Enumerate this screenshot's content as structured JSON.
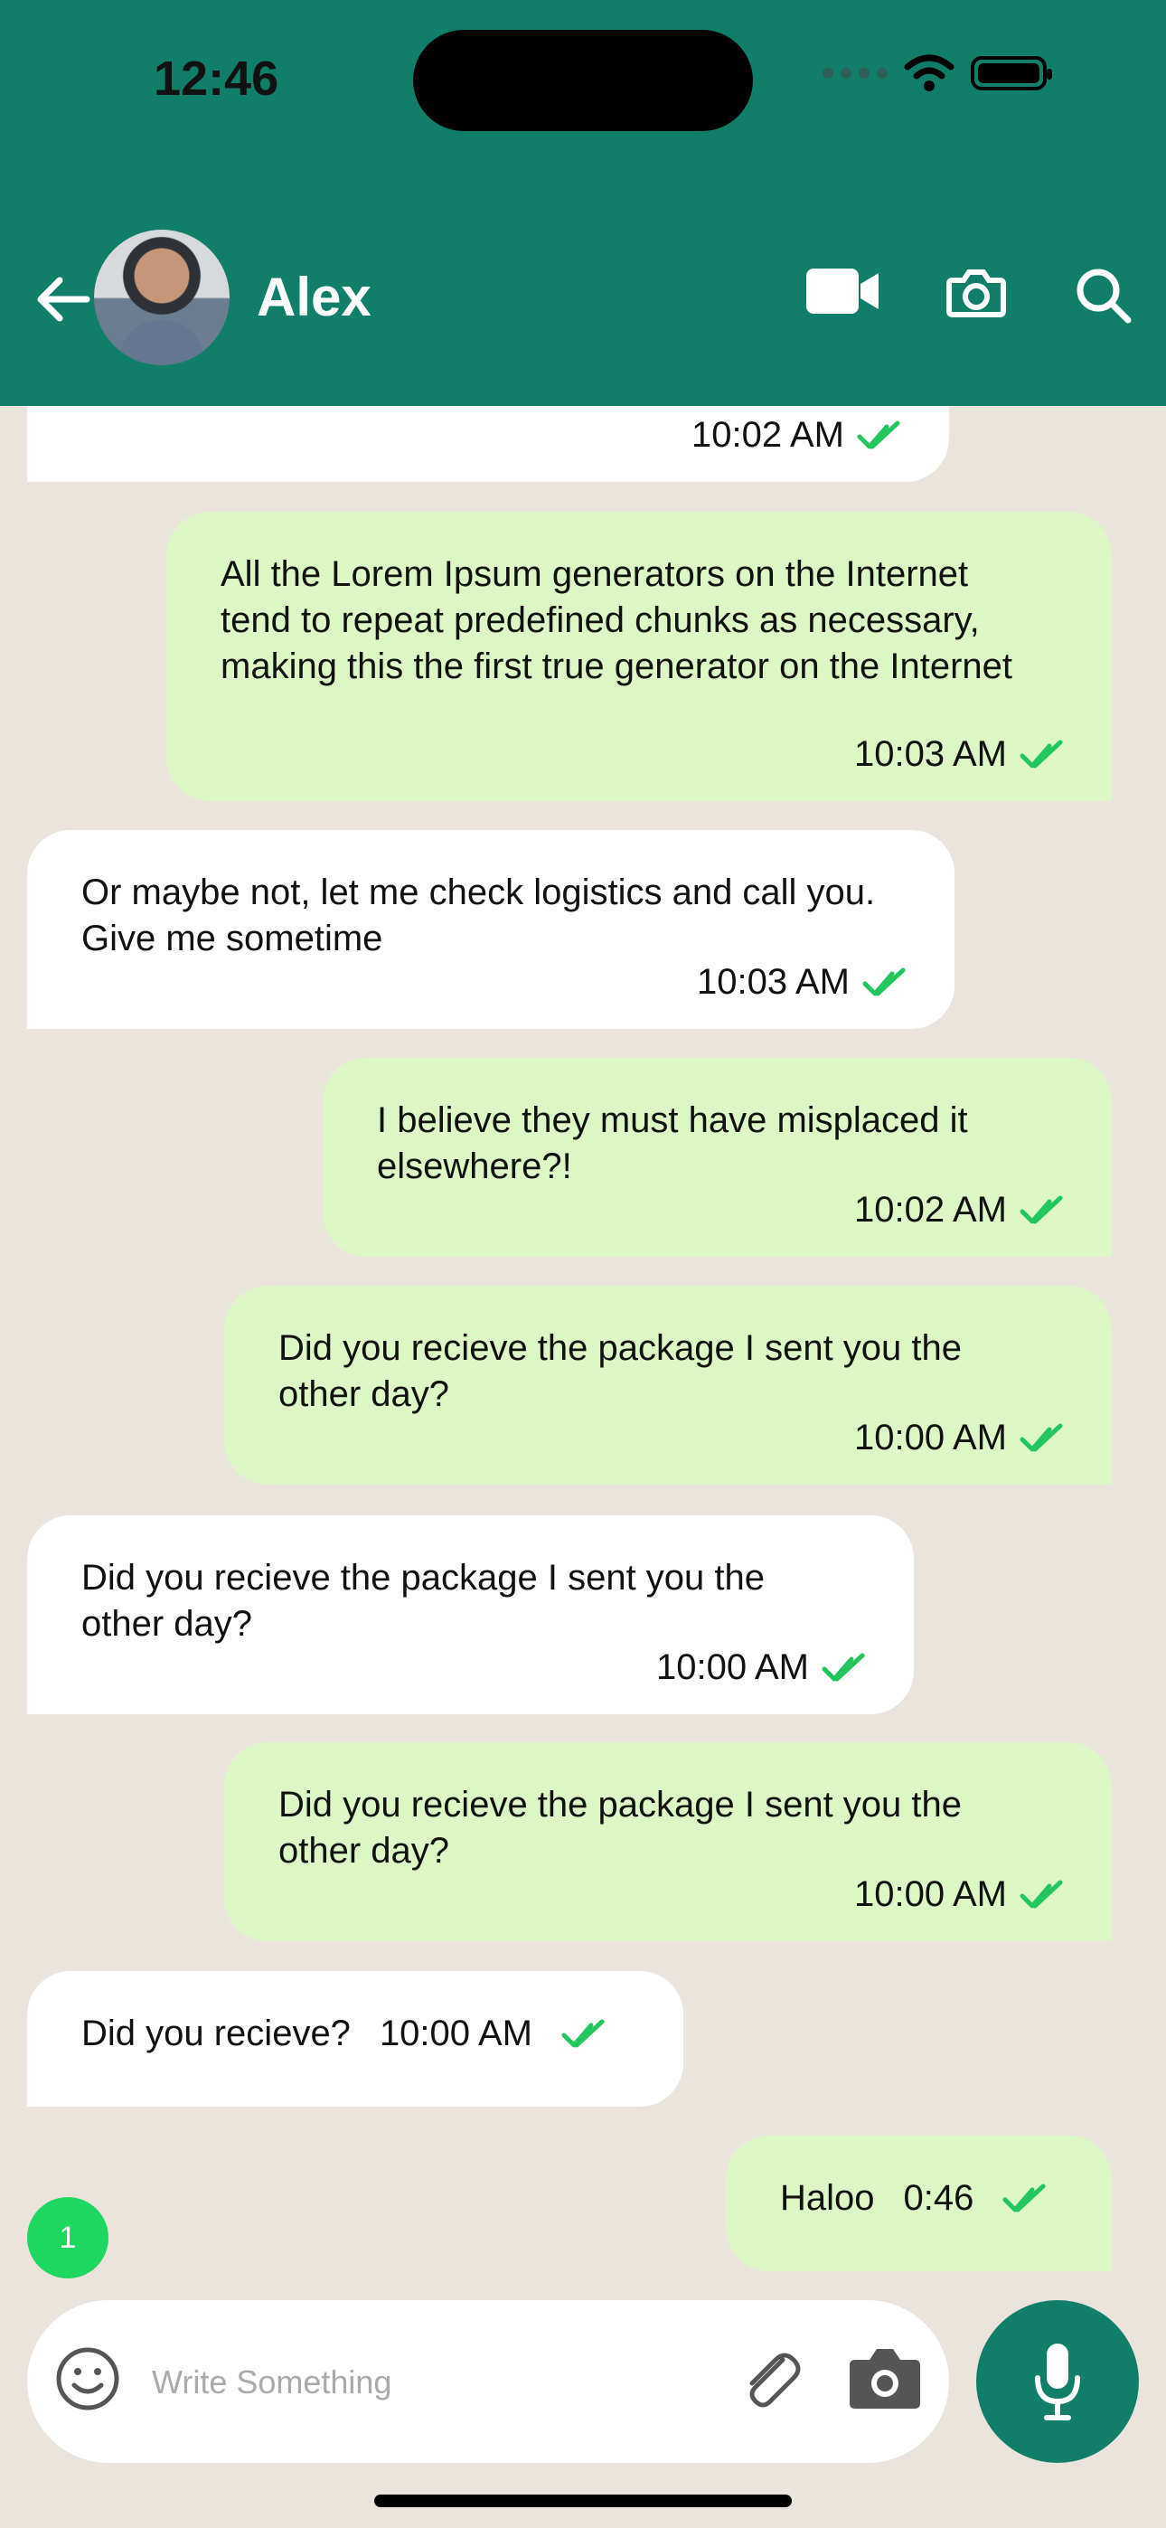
{
  "status": {
    "time": "12:46"
  },
  "header": {
    "name": "Alex"
  },
  "messages": [
    {
      "side": "received",
      "time": "10:02 AM"
    },
    {
      "side": "sent",
      "text": "All the Lorem Ipsum generators on the Internet tend to repeat predefined chunks as necessary, making this the first true generator on the Internet",
      "time": "10:03 AM"
    },
    {
      "side": "received",
      "text": "Or maybe not, let me check logistics and call you. Give me sometime",
      "time": "10:03 AM"
    },
    {
      "side": "sent",
      "text": "I believe they must have misplaced it elsewhere?!",
      "time": "10:02 AM"
    },
    {
      "side": "sent",
      "text": "Did you recieve the package I sent you the other day?",
      "time": "10:00 AM"
    },
    {
      "side": "received",
      "text": "Did you recieve the package I sent you the other day?",
      "time": "10:00 AM"
    },
    {
      "side": "sent",
      "text": "Did you recieve the package I sent you the other day?",
      "time": "10:00 AM"
    },
    {
      "side": "received",
      "text": "Did you recieve?",
      "time": "10:00 AM"
    },
    {
      "side": "sent",
      "text": "Haloo",
      "time": "0:46"
    }
  ],
  "unread_count": "1",
  "composer": {
    "placeholder": "Write Something"
  },
  "colors": {
    "header": "#117e6a",
    "sent_bubble": "#dcf7c5",
    "received_bubble": "#ffffff",
    "check": "#22c55e"
  }
}
